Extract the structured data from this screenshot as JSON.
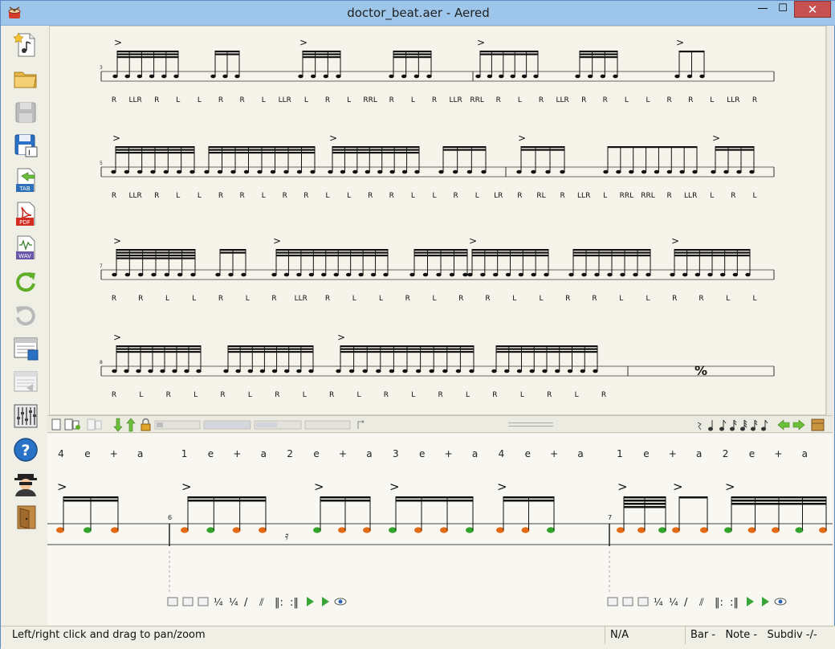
{
  "window": {
    "title": "doctor_beat.aer - Aered",
    "controls": {
      "minimize": "—",
      "maximize": "☐",
      "close": "✕"
    }
  },
  "toolbar": {
    "items": [
      {
        "name": "new-file",
        "icon": "new-music-file-icon"
      },
      {
        "name": "open-file",
        "icon": "folder-icon"
      },
      {
        "name": "save-file",
        "icon": "floppy-disk-icon",
        "disabled": true
      },
      {
        "name": "save-as",
        "icon": "save-as-icon"
      },
      {
        "name": "export-tab",
        "icon": "export-tab-icon",
        "label": "TAB"
      },
      {
        "name": "export-pdf",
        "icon": "export-pdf-icon",
        "label": "PDF"
      },
      {
        "name": "export-wav",
        "icon": "export-wav-icon",
        "label": "WAV"
      },
      {
        "name": "redo",
        "icon": "redo-icon"
      },
      {
        "name": "undo",
        "icon": "undo-icon",
        "disabled": true
      },
      {
        "name": "save-region",
        "icon": "save-region-icon"
      },
      {
        "name": "load-region",
        "icon": "load-region-icon",
        "disabled": true
      },
      {
        "name": "mixer",
        "icon": "mixer-icon"
      },
      {
        "name": "help",
        "icon": "help-icon",
        "label": "?"
      },
      {
        "name": "about",
        "icon": "spy-avatar-icon"
      },
      {
        "name": "exit",
        "icon": "exit-door-icon"
      }
    ]
  },
  "score": {
    "systems": [
      {
        "first_bar": "3",
        "stickings": [
          "R",
          "LLR",
          "R",
          "L",
          "L",
          "R",
          "R",
          "L",
          "LLR",
          "L",
          "R",
          "L",
          "RRL",
          "R",
          "L",
          "R",
          "LLR",
          "RRL",
          "R",
          "L",
          "R",
          "LLR",
          "R",
          "R",
          "L",
          "L",
          "R",
          "R",
          "L",
          "LLR",
          "R"
        ]
      },
      {
        "first_bar": "5",
        "stickings": [
          "R",
          "LLR",
          "R",
          "L",
          "L",
          "R",
          "R",
          "L",
          "R",
          "R",
          "L",
          "L",
          "R",
          "R",
          "L",
          "L",
          "R",
          "L",
          "LR",
          "R",
          "RL",
          "R",
          "LLR",
          "L",
          "RRL",
          "RRL",
          "R",
          "LLR",
          "L",
          "R",
          "L"
        ]
      },
      {
        "first_bar": "7",
        "stickings": [
          "R",
          "R",
          "L",
          "L",
          "R",
          "L",
          "R",
          "LLR",
          "R",
          "L",
          "L",
          "R",
          "L",
          "R",
          "R",
          "L",
          "L",
          "R",
          "R",
          "L",
          "L",
          "R",
          "R",
          "L",
          "L"
        ]
      },
      {
        "first_bar": "8",
        "stickings": [
          "R",
          "L",
          "R",
          "L",
          "R",
          "L",
          "R",
          "L",
          "R",
          "L",
          "R",
          "L",
          "R",
          "L",
          "R",
          "L",
          "R",
          "L",
          "R"
        ]
      }
    ]
  },
  "editor": {
    "beat_counts": [
      "4",
      "e",
      "+",
      "a",
      "1",
      "e",
      "+",
      "a",
      "2",
      "e",
      "+",
      "a",
      "3",
      "e",
      "+",
      "a",
      "4",
      "e",
      "+",
      "a",
      "1",
      "e",
      "+",
      "a",
      "2",
      "e",
      "+",
      "a"
    ],
    "bar_numbers": [
      "6",
      "7"
    ],
    "note_colors": {
      "right": "#e36a12",
      "left": "#33a32c"
    }
  },
  "status": {
    "message": "Left/right click and drag to pan/zoom",
    "value": "N/A",
    "position": "Bar -   Note -   Subdiv -/-"
  }
}
